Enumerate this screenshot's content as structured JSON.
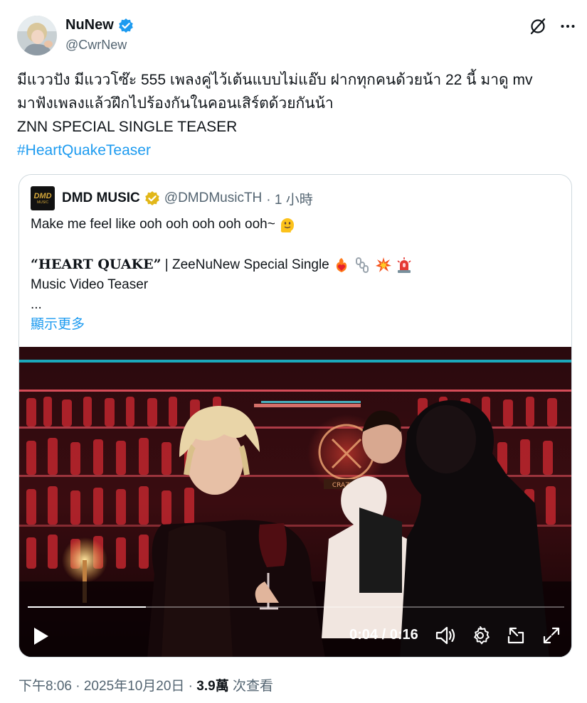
{
  "tweet": {
    "author_name": "NuNew",
    "author_handle": "@CwrNew",
    "lines": [
      "มีแววปัง มีแววโซ๊ะ 555 เพลงคู่ไว้เต้นแบบไม่แอ๊บ ฝากทุกคนด้วยน้า 22 นี้ มาดู mv",
      "มาฟังเพลงแล้วฝึกไปร้องกันในคอนเสิร์ตด้วยกันน้า",
      "ZNN SPECIAL SINGLE TEASER"
    ],
    "hashtag": "#HeartQuakeTeaser",
    "footer_time": "下午8:06 · 2025年10月20日",
    "footer_sep": " · ",
    "views_count": "3.9萬",
    "views_label": " 次查看"
  },
  "header_icons": [
    "grok-icon",
    "more-icon"
  ],
  "quote": {
    "logo_text": "DMD",
    "logo_sub": "MUSIC",
    "author_name": "DMD MUSIC",
    "author_handle": "@DMDMusicTH",
    "time": "· 1 小時",
    "line1": "Make me feel like ooh ooh ooh ooh ooh~",
    "title": "“HEART QUAKE”",
    "title_rest": " | ZeeNuNew Special Single",
    "line3": "Music Video Teaser",
    "ellipsis": "...",
    "show_more": "顯示更多"
  },
  "video": {
    "current_time": "0:04",
    "duration": "0:16",
    "time_display": "0:04 / 0:16",
    "progress_fraction": 0.22,
    "neon_sign_text": "CRAZY IN"
  },
  "colors": {
    "accent": "#1d9bf0",
    "text": "#0f1419",
    "secondary": "#536471",
    "border": "#cfd9de"
  }
}
